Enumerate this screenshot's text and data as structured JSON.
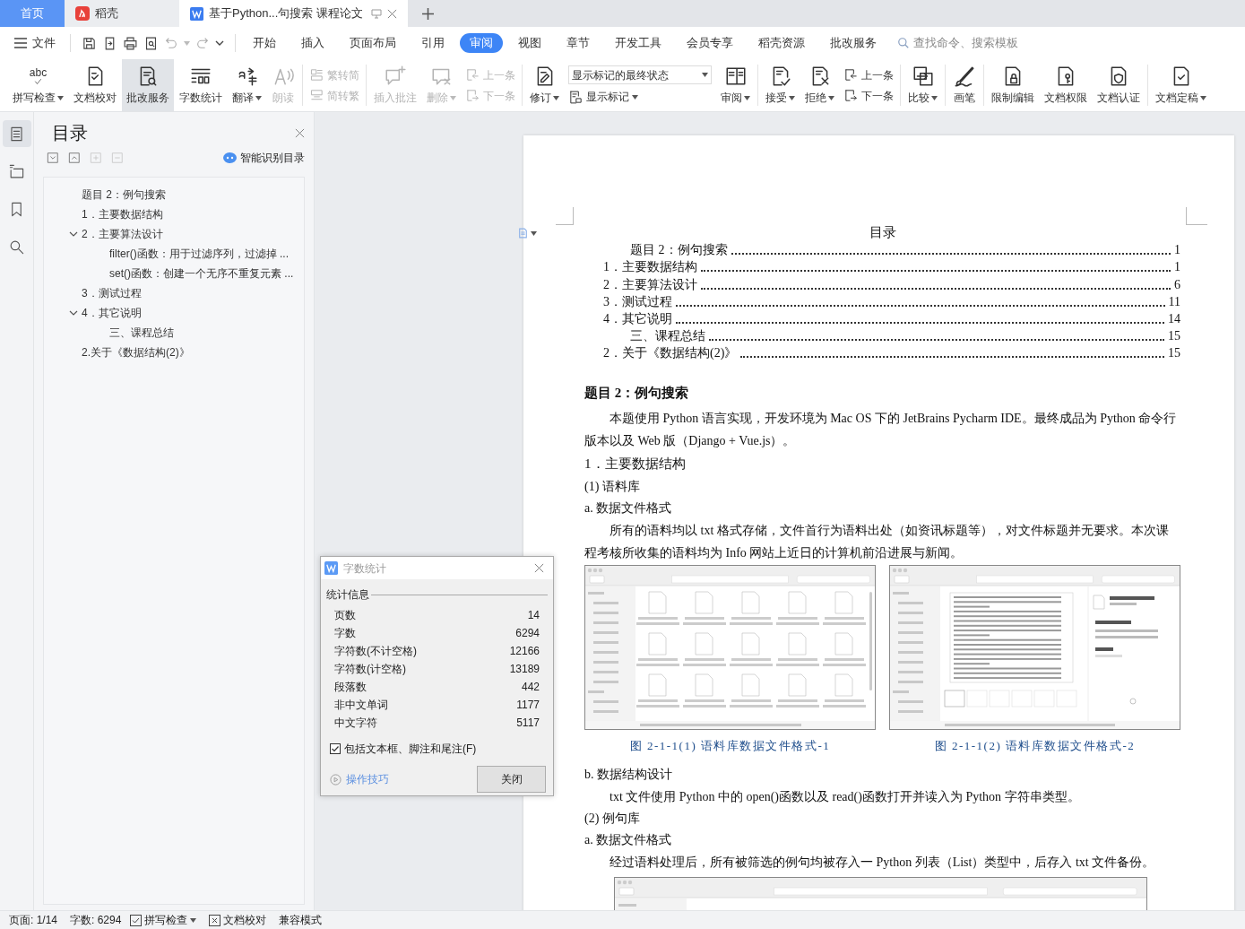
{
  "tabs": [
    {
      "label": "首页",
      "kind": "home",
      "selected": false
    },
    {
      "label": "稻壳",
      "kind": "docer",
      "selected": false
    },
    {
      "label": "基于Python...句搜索 课程论文",
      "kind": "doc",
      "selected": true
    }
  ],
  "menu": {
    "file": "文件",
    "tabs": [
      {
        "label": "开始",
        "selected": false
      },
      {
        "label": "插入",
        "selected": false
      },
      {
        "label": "页面布局",
        "selected": false
      },
      {
        "label": "引用",
        "selected": false
      },
      {
        "label": "审阅",
        "selected": true
      },
      {
        "label": "视图",
        "selected": false
      },
      {
        "label": "章节",
        "selected": false
      },
      {
        "label": "开发工具",
        "selected": false
      },
      {
        "label": "会员专享",
        "selected": false
      },
      {
        "label": "稻壳资源",
        "selected": false
      },
      {
        "label": "批改服务",
        "selected": false
      }
    ],
    "search_placeholder": "查找命令、搜索模板"
  },
  "ribbon": [
    [
      {
        "kind": "large",
        "label": "拼写检查",
        "icon_text": "abc",
        "dropdown": true,
        "disabled": false,
        "highlighted": false
      },
      {
        "kind": "large",
        "label": "文档校对",
        "dropdown": false,
        "disabled": false,
        "highlighted": false
      },
      {
        "kind": "large",
        "label": "批改服务",
        "dropdown": false,
        "disabled": false,
        "highlighted": true
      },
      {
        "kind": "large",
        "label": "字数统计",
        "dropdown": false,
        "disabled": false,
        "highlighted": false
      },
      {
        "kind": "large",
        "label": "翻译",
        "dropdown": true,
        "disabled": false,
        "highlighted": false
      },
      {
        "kind": "large",
        "label": "朗读",
        "dropdown": false,
        "disabled": true,
        "highlighted": false
      }
    ],
    [
      {
        "kind": "small",
        "items": [
          {
            "label": "繁转简",
            "dropdown": false,
            "disabled": true
          },
          {
            "label": "简转繁",
            "dropdown": false,
            "disabled": true
          }
        ]
      }
    ],
    [
      {
        "kind": "large",
        "label": "插入批注",
        "dropdown": false,
        "disabled": true,
        "highlighted": false
      },
      {
        "kind": "large",
        "label": "删除",
        "dropdown": true,
        "disabled": true,
        "highlighted": false
      },
      {
        "kind": "small",
        "items": [
          {
            "label": "上一条",
            "dropdown": false,
            "disabled": true
          },
          {
            "label": "下一条",
            "dropdown": false,
            "disabled": true
          }
        ]
      }
    ],
    [
      {
        "kind": "large",
        "label": "修订",
        "dropdown": true,
        "disabled": false,
        "highlighted": false
      },
      {
        "kind": "select",
        "value": "显示标记的最终状态",
        "below": {
          "label": "显示标记",
          "dropdown": true,
          "disabled": false
        }
      },
      {
        "kind": "large",
        "label": "审阅",
        "dropdown": true,
        "disabled": false,
        "highlighted": false
      }
    ],
    [
      {
        "kind": "large",
        "label": "接受",
        "dropdown": true,
        "disabled": false,
        "highlighted": false
      },
      {
        "kind": "large",
        "label": "拒绝",
        "dropdown": true,
        "disabled": false,
        "highlighted": false
      },
      {
        "kind": "small",
        "items": [
          {
            "label": "上一条",
            "dropdown": false,
            "disabled": false
          },
          {
            "label": "下一条",
            "dropdown": false,
            "disabled": false
          }
        ]
      }
    ],
    [
      {
        "kind": "large",
        "label": "比较",
        "dropdown": true,
        "disabled": false,
        "highlighted": false
      }
    ],
    [
      {
        "kind": "large",
        "label": "画笔",
        "dropdown": false,
        "disabled": false,
        "highlighted": false
      }
    ],
    [
      {
        "kind": "large",
        "label": "限制编辑",
        "dropdown": false,
        "disabled": false,
        "highlighted": false
      },
      {
        "kind": "large",
        "label": "文档权限",
        "dropdown": false,
        "disabled": false,
        "highlighted": false
      },
      {
        "kind": "large",
        "label": "文档认证",
        "dropdown": false,
        "disabled": false,
        "highlighted": false
      }
    ],
    [
      {
        "kind": "large",
        "label": "文档定稿",
        "dropdown": true,
        "disabled": false,
        "highlighted": false
      }
    ]
  ],
  "side_tabs": [
    {
      "selected": true
    },
    {
      "selected": false
    },
    {
      "selected": false
    },
    {
      "selected": false
    }
  ],
  "toc_panel": {
    "title": "目录",
    "tools": [
      {
        "disabled": false
      },
      {
        "disabled": false
      },
      {
        "disabled": true
      },
      {
        "disabled": true
      }
    ],
    "smart": "智能识别目录",
    "items": [
      {
        "label": "题目 2：例句搜索"
      },
      {
        "label": "1．主要数据结构"
      },
      {
        "label": "2．主要算法设计",
        "expanded": true,
        "children": [
          {
            "label": "filter()函数：用于过滤序列，过滤掉 ..."
          },
          {
            "label": "set()函数：创建一个无序不重复元素 ..."
          }
        ]
      },
      {
        "label": "3．测试过程"
      },
      {
        "label": "4．其它说明",
        "expanded": true,
        "children": [
          {
            "label": "三、课程总结"
          }
        ]
      },
      {
        "label": "2.关于《数据结构(2)》"
      }
    ]
  },
  "document": {
    "toc_title": "目录",
    "toc": [
      {
        "kind": "sub",
        "label": "题目 2：例句搜索",
        "page": "1"
      },
      {
        "kind": "main",
        "label": "1．主要数据结构",
        "page": "1"
      },
      {
        "kind": "main",
        "label": "2．主要算法设计",
        "page": "6"
      },
      {
        "kind": "main",
        "label": "3．测试过程",
        "page": "11"
      },
      {
        "kind": "main",
        "label": "4．其它说明",
        "page": "14"
      },
      {
        "kind": "sub",
        "label": "三、课程总结",
        "page": "15"
      },
      {
        "kind": "main",
        "label": "2．关于《数据结构(2)》",
        "page": "15"
      }
    ],
    "body": [
      {
        "kind": "title",
        "text": "题目 2：例句搜索"
      },
      {
        "kind": "paragraph",
        "text": "本题使用 Python 语言实现，开发环境为 Mac OS 下的 JetBrains Pycharm IDE。最终成品为 Python 命令行版本以及 Web 版（Django + Vue.js）。"
      },
      {
        "kind": "heading",
        "text": "1．主要数据结构"
      },
      {
        "kind": "line",
        "text": "(1) 语料库"
      },
      {
        "kind": "line",
        "text": "a. 数据文件格式"
      },
      {
        "kind": "paragraph",
        "text": "所有的语料均以 txt 格式存储，文件首行为语料出处（如资讯标题等），对文件标题并无要求。本次课程考核所收集的语料均为 Info 网站上近日的计算机前沿进展与新闻。"
      },
      {
        "kind": "figures",
        "items": [
          {
            "kind": "file-grid",
            "caption": "图 2-1-1(1) 语料库数据文件格式-1"
          },
          {
            "kind": "preview",
            "caption": "图 2-1-1(2) 语料库数据文件格式-2"
          }
        ]
      },
      {
        "kind": "line",
        "text": "b. 数据结构设计"
      },
      {
        "kind": "paragraph",
        "text": "txt 文件使用 Python 中的 open()函数以及 read()函数打开并读入为 Python 字符串类型。"
      },
      {
        "kind": "line",
        "text": "(2) 例句库"
      },
      {
        "kind": "line",
        "text": "a. 数据文件格式"
      },
      {
        "kind": "paragraph",
        "text": "经过语料处理后，所有被筛选的例句均被存入一 Python 列表（List）类型中，后存入 txt 文件备份。"
      },
      {
        "kind": "partial_figure"
      }
    ]
  },
  "word_count_dialog": {
    "title": "字数统计",
    "section": "统计信息",
    "rows": [
      {
        "label": "页数",
        "value": "14"
      },
      {
        "label": "字数",
        "value": "6294"
      },
      {
        "label": "字符数(不计空格)",
        "value": "12166"
      },
      {
        "label": "字符数(计空格)",
        "value": "13189"
      },
      {
        "label": "段落数",
        "value": "442"
      },
      {
        "label": "非中文单词",
        "value": "1177"
      },
      {
        "label": "中文字符",
        "value": "5117"
      }
    ],
    "include_notes": {
      "label": "包括文本框、脚注和尾注(F)",
      "checked": true
    },
    "tips": "操作技巧",
    "close": "关闭"
  },
  "status_bar": {
    "page": "页面: 1/14",
    "words": "字数: 6294",
    "spell": "拼写检查",
    "proof": "文档校对",
    "mode": "兼容模式"
  }
}
